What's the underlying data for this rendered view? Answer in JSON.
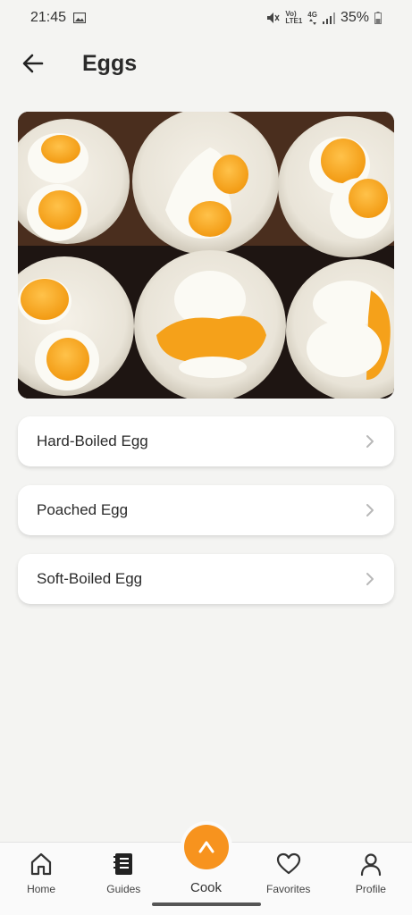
{
  "status_bar": {
    "time": "21:45",
    "network_top": "Vo)",
    "network_bottom": "LTE1",
    "net_4g": "4G",
    "battery": "35%"
  },
  "header": {
    "title": "Eggs"
  },
  "guides": [
    {
      "label": "Hard-Boiled Egg"
    },
    {
      "label": "Poached Egg"
    },
    {
      "label": "Soft-Boiled Egg"
    }
  ],
  "nav": {
    "home": "Home",
    "guides": "Guides",
    "cook": "Cook",
    "favorites": "Favorites",
    "profile": "Profile"
  },
  "colors": {
    "accent": "#f7931e",
    "background": "#f4f4f2"
  }
}
